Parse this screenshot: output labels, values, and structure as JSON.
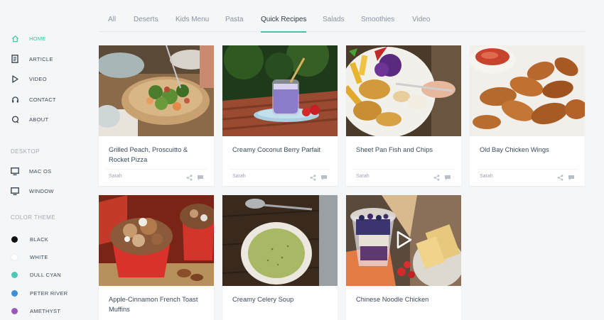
{
  "sidebar": {
    "nav": [
      {
        "label": "HOME",
        "icon": "home-icon",
        "active": true
      },
      {
        "label": "ARTICLE",
        "icon": "document-icon",
        "active": false
      },
      {
        "label": "VIDEO",
        "icon": "play-icon",
        "active": false
      },
      {
        "label": "CONTACT",
        "icon": "headphones-icon",
        "active": false
      },
      {
        "label": "ABOUT",
        "icon": "chat-bubble-icon",
        "active": false
      }
    ],
    "desktop_title": "DESKTOP",
    "desktop": [
      {
        "label": "MAC OS",
        "icon": "monitor-icon"
      },
      {
        "label": "WINDOW",
        "icon": "monitor-icon"
      }
    ],
    "theme_title": "COLOR THEME",
    "themes": [
      {
        "label": "BLACK",
        "color": "#111111"
      },
      {
        "label": "WHITE",
        "color": "#ffffff"
      },
      {
        "label": "DULL CYAN",
        "color": "#4ec9b8"
      },
      {
        "label": "PETER RIVER",
        "color": "#3b8fd9"
      },
      {
        "label": "AMETHYST",
        "color": "#9b59b6"
      }
    ]
  },
  "tabs": [
    {
      "label": "All",
      "active": false
    },
    {
      "label": "Deserts",
      "active": false
    },
    {
      "label": "Kids Menu",
      "active": false
    },
    {
      "label": "Pasta",
      "active": false
    },
    {
      "label": "Quick Recipes",
      "active": true
    },
    {
      "label": "Salads",
      "active": false
    },
    {
      "label": "Smoothies",
      "active": false
    },
    {
      "label": "Video",
      "active": false
    }
  ],
  "accent_color": "#40c4a4",
  "cards": [
    {
      "title": "Grilled Peach, Proscuitto & Rocket Pizza",
      "author": "Sarah",
      "image": "pizza-photo"
    },
    {
      "title": "Creamy Coconut Berry Parfait",
      "author": "Sarah",
      "image": "berry-smoothie-photo"
    },
    {
      "title": "Sheet Pan Fish and Chips",
      "author": "Sarah",
      "image": "fish-and-chips-photo"
    },
    {
      "title": "Old Bay Chicken Wings",
      "author": "Sarah",
      "image": "chicken-wings-photo"
    },
    {
      "title": "Apple-Cinnamon French Toast Muffins",
      "author": "",
      "image": "muffins-photo"
    },
    {
      "title": "Creamy Celery Soup",
      "author": "",
      "image": "celery-soup-photo"
    },
    {
      "title": "Chinese Noodle Chicken",
      "author": "",
      "image": "parfait-video-photo",
      "video": true
    }
  ]
}
